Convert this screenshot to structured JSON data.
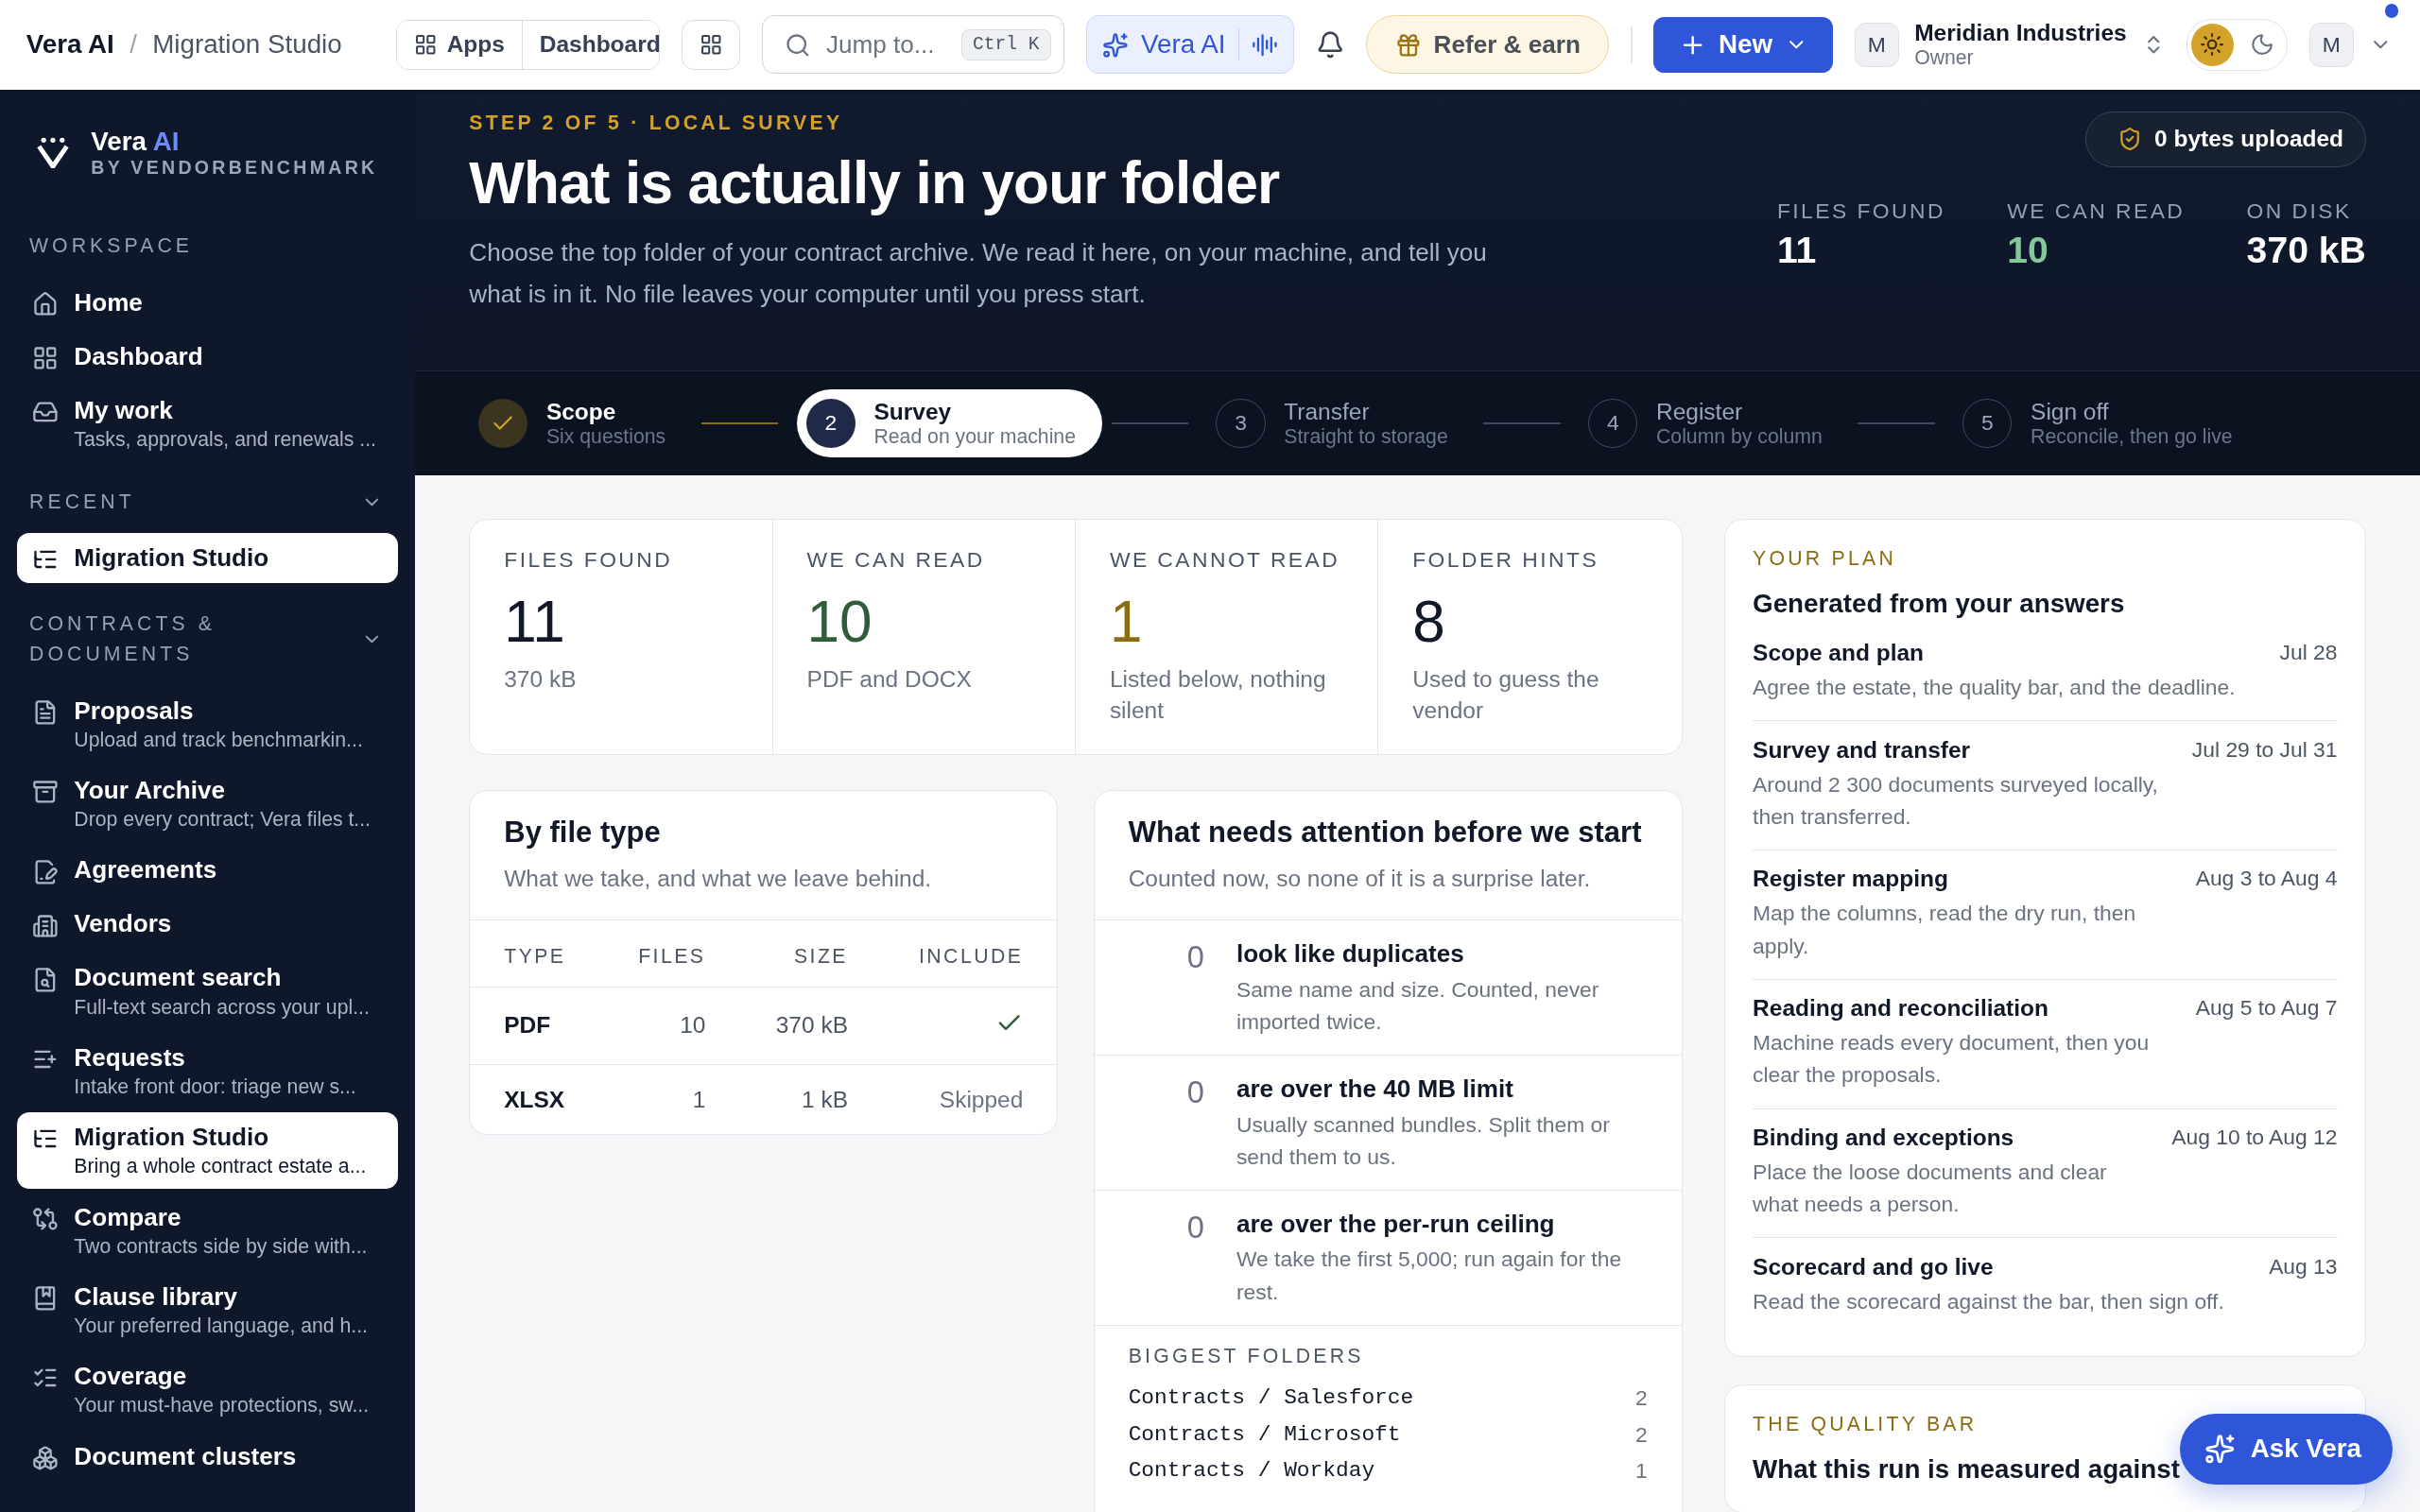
{
  "topbar": {
    "breadcrumb": [
      {
        "label": "Vera AI",
        "current": false
      },
      {
        "label": "Migration Studio",
        "current": true
      }
    ],
    "breadcrumb_separator": "/",
    "apps_label": "Apps",
    "dashboard_label": "Dashboard",
    "search": {
      "placeholder": "Jump to...",
      "shortcut": "Ctrl K"
    },
    "assistant_label": "Vera AI",
    "refer_label": "Refer & earn",
    "new_label": "New",
    "org": {
      "avatar": "M",
      "name": "Meridian Industries",
      "role": "Owner"
    },
    "theme_options": [
      {
        "kind": "light",
        "selected": true
      },
      {
        "kind": "dark",
        "selected": false
      }
    ],
    "user_avatar": "M",
    "unread": true
  },
  "sidebar": {
    "brand": {
      "name": "Vera",
      "accent": "AI",
      "tagline": "BY VENDORBENCHMARK"
    },
    "sections": [
      {
        "title": "WORKSPACE",
        "items": [
          {
            "kind": "home",
            "label": "Home",
            "selected": false
          },
          {
            "kind": "grid",
            "label": "Dashboard",
            "selected": false
          },
          {
            "kind": "inbox",
            "label": "My work",
            "subtitle": "Tasks, approvals, and renewals ...",
            "selected": false
          }
        ]
      },
      {
        "title": "RECENT",
        "expanded": true,
        "items": [
          {
            "kind": "tree",
            "label": "Migration Studio",
            "selected": true
          }
        ]
      },
      {
        "title": "CONTRACTS & DOCUMENTS",
        "expanded": true,
        "items": [
          {
            "kind": "file",
            "label": "Proposals",
            "subtitle": "Upload and track benchmarkin...",
            "selected": false
          },
          {
            "kind": "archive",
            "label": "Your Archive",
            "subtitle": "Drop every contract; Vera files t...",
            "selected": false
          },
          {
            "kind": "pen",
            "label": "Agreements",
            "selected": false
          },
          {
            "kind": "building",
            "label": "Vendors",
            "selected": false
          },
          {
            "kind": "search-file",
            "label": "Document search",
            "subtitle": "Full-text search across your upl...",
            "selected": false
          },
          {
            "kind": "list-plus",
            "label": "Requests",
            "subtitle": "Intake front door: triage new s...",
            "selected": false
          },
          {
            "kind": "tree",
            "label": "Migration Studio",
            "subtitle": "Bring a whole contract estate a...",
            "selected": true
          },
          {
            "kind": "compare",
            "label": "Compare",
            "subtitle": "Two contracts side by side with...",
            "selected": false
          },
          {
            "kind": "book",
            "label": "Clause library",
            "subtitle": "Your preferred language, and h...",
            "selected": false
          },
          {
            "kind": "checks",
            "label": "Coverage",
            "subtitle": "Your must-have protections, sw...",
            "selected": false
          },
          {
            "kind": "boxes",
            "label": "Document clusters",
            "selected": false
          }
        ]
      }
    ]
  },
  "hero": {
    "step_label": "STEP 2 OF 5 · LOCAL SURVEY",
    "title": "What is actually in your folder",
    "description": "Choose the top folder of your contract archive. We read it here, on your machine, and tell you what is in it. No file leaves your computer until you press start.",
    "upload_badge": "0 bytes uploaded",
    "stats": [
      {
        "label": "FILES FOUND",
        "value": "11",
        "color": "#ffffff"
      },
      {
        "label": "WE CAN READ",
        "value": "10",
        "color": "#86c79a"
      },
      {
        "label": "ON DISK",
        "value": "370 kB",
        "color": "#ffffff"
      }
    ]
  },
  "steps": [
    {
      "done": true,
      "selected": false,
      "title": "Scope",
      "subtitle": "Six questions"
    },
    {
      "done": false,
      "selected": true,
      "number": "2",
      "title": "Survey",
      "subtitle": "Read on your machine"
    },
    {
      "done": false,
      "selected": false,
      "number": "3",
      "title": "Transfer",
      "subtitle": "Straight to storage"
    },
    {
      "done": false,
      "selected": false,
      "number": "4",
      "title": "Register",
      "subtitle": "Column by column"
    },
    {
      "done": false,
      "selected": false,
      "number": "5",
      "title": "Sign off",
      "subtitle": "Reconcile, then go live"
    }
  ],
  "summary": [
    {
      "label": "FILES FOUND",
      "value": "11",
      "note": "370 kB",
      "color": "#111827"
    },
    {
      "label": "WE CAN READ",
      "value": "10",
      "note": "PDF and DOCX",
      "color": "#2f5d3a"
    },
    {
      "label": "WE CANNOT READ",
      "value": "1",
      "note": "Listed below, nothing silent",
      "color": "#8a6d12"
    },
    {
      "label": "FOLDER HINTS",
      "value": "8",
      "note": "Used to guess the vendor",
      "color": "#111827"
    }
  ],
  "file_types": {
    "title": "By file type",
    "subtitle": "What we take, and what we leave behind.",
    "columns": [
      "TYPE",
      "FILES",
      "SIZE",
      "INCLUDE"
    ],
    "rows": [
      {
        "cells": [
          "PDF",
          "10",
          "370 kB"
        ],
        "included": true
      },
      {
        "cells": [
          "XLSX",
          "1",
          "1 kB"
        ],
        "included": false,
        "include_text": "Skipped"
      }
    ]
  },
  "attention": {
    "title": "What needs attention before we start",
    "subtitle": "Counted now, so none of it is a surprise later.",
    "items": [
      {
        "count": "0",
        "title": "look like duplicates",
        "description": "Same name and size. Counted, never imported twice."
      },
      {
        "count": "0",
        "title": "are over the 40 MB limit",
        "description": "Usually scanned bundles. Split them or send them to us."
      },
      {
        "count": "0",
        "title": "are over the per-run ceiling",
        "description": "We take the first 5,000; run again for the rest."
      }
    ],
    "folders_title": "BIGGEST FOLDERS",
    "folders": [
      {
        "path": "Contracts / Salesforce",
        "count": "2"
      },
      {
        "path": "Contracts / Microsoft",
        "count": "2"
      },
      {
        "path": "Contracts / Workday",
        "count": "1"
      }
    ]
  },
  "plan": {
    "eyebrow": "YOUR PLAN",
    "title": "Generated from your answers",
    "items": [
      {
        "title": "Scope and plan",
        "date": "Jul 28",
        "description": "Agree the estate, the quality bar, and the deadline."
      },
      {
        "title": "Survey and transfer",
        "date": "Jul 29 to Jul 31",
        "description": "Around 2 300 documents surveyed locally, then transferred."
      },
      {
        "title": "Register mapping",
        "date": "Aug 3 to Aug 4",
        "description": "Map the columns, read the dry run, then apply."
      },
      {
        "title": "Reading and reconciliation",
        "date": "Aug 5 to Aug 7",
        "description": "Machine reads every document, then you clear the proposals."
      },
      {
        "title": "Binding and exceptions",
        "date": "Aug 10 to Aug 12",
        "description": "Place the loose documents and clear what needs a person."
      },
      {
        "title": "Scorecard and go live",
        "date": "Aug 13",
        "description": "Read the scorecard against the bar, then sign off."
      }
    ]
  },
  "quality": {
    "eyebrow": "THE QUALITY BAR",
    "title": "What this run is measured against"
  },
  "ask_button": "Ask Vera"
}
